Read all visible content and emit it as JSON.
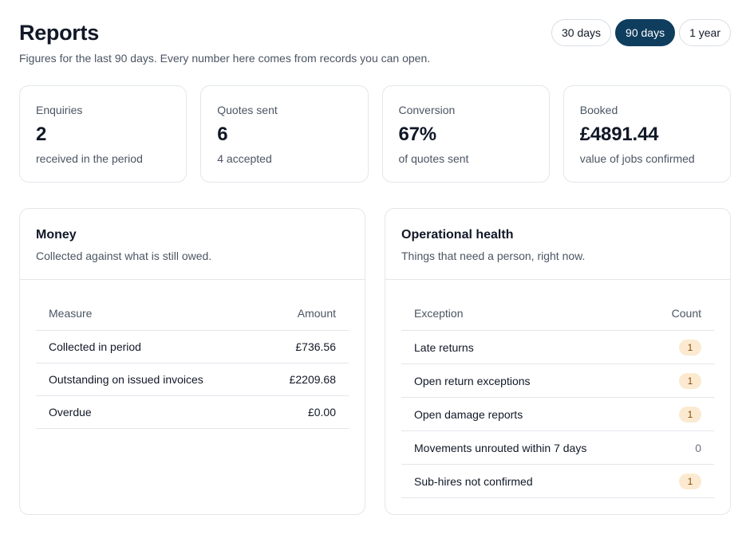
{
  "header": {
    "title": "Reports",
    "subtitle": "Figures for the last 90 days. Every number here comes from records you can open.",
    "ranges": [
      {
        "label": "30 days",
        "active": false
      },
      {
        "label": "90 days",
        "active": true
      },
      {
        "label": "1 year",
        "active": false
      }
    ]
  },
  "stats": [
    {
      "label": "Enquiries",
      "value": "2",
      "note": "received in the period"
    },
    {
      "label": "Quotes sent",
      "value": "6",
      "note": "4 accepted"
    },
    {
      "label": "Conversion",
      "value": "67%",
      "note": "of quotes sent"
    },
    {
      "label": "Booked",
      "value": "£4891.44",
      "note": "value of jobs confirmed"
    }
  ],
  "money": {
    "title": "Money",
    "subtitle": "Collected against what is still owed.",
    "col_measure": "Measure",
    "col_amount": "Amount",
    "rows": [
      {
        "measure": "Collected in period",
        "amount": "£736.56"
      },
      {
        "measure": "Outstanding on issued invoices",
        "amount": "£2209.68"
      },
      {
        "measure": "Overdue",
        "amount": "£0.00"
      }
    ]
  },
  "ops": {
    "title": "Operational health",
    "subtitle": "Things that need a person, right now.",
    "col_exception": "Exception",
    "col_count": "Count",
    "rows": [
      {
        "exception": "Late returns",
        "count": "1",
        "flagged": true
      },
      {
        "exception": "Open return exceptions",
        "count": "1",
        "flagged": true
      },
      {
        "exception": "Open damage reports",
        "count": "1",
        "flagged": true
      },
      {
        "exception": "Movements unrouted within 7 days",
        "count": "0",
        "flagged": false
      },
      {
        "exception": "Sub-hires not confirmed",
        "count": "1",
        "flagged": true
      }
    ]
  },
  "colors": {
    "accent": "#0f3d5e",
    "badge_bg": "#fbead0",
    "badge_text": "#8a4b0b"
  }
}
